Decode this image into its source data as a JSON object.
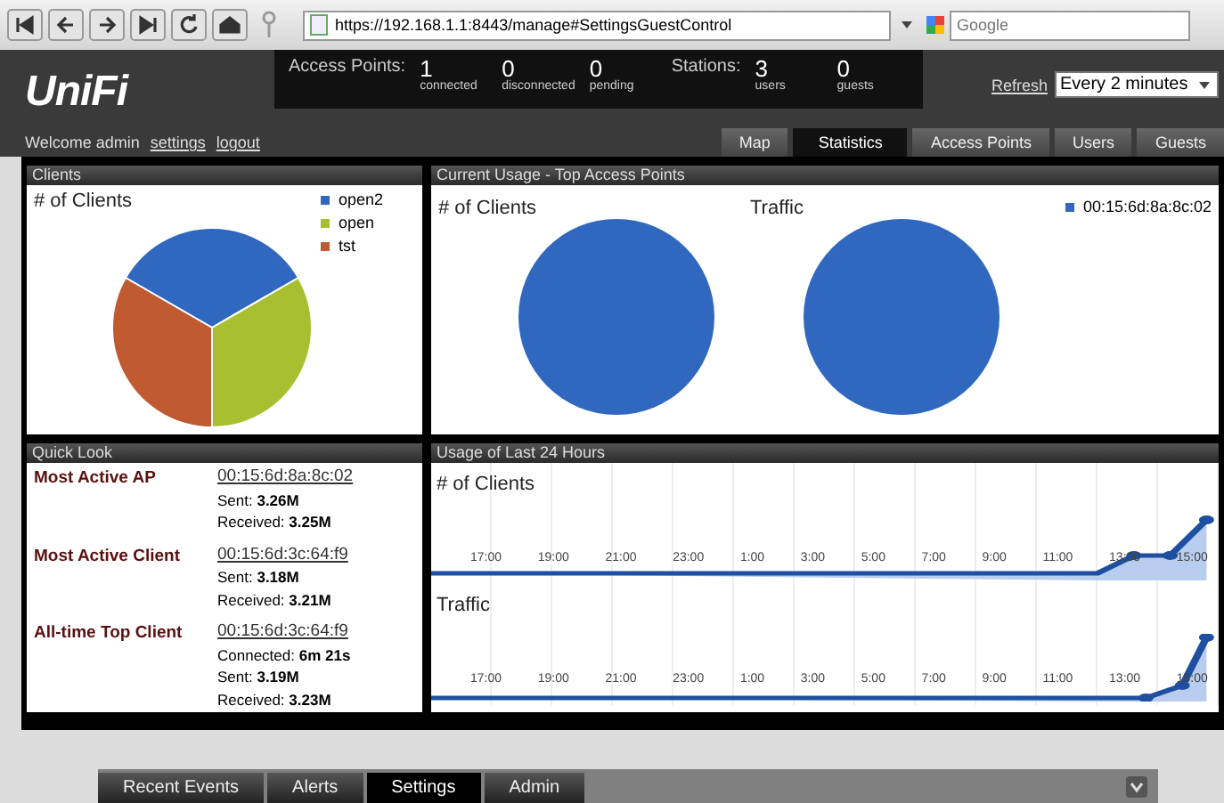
{
  "browser": {
    "url": "https://192.168.1.1:8443/manage#SettingsGuestControl",
    "search": {
      "placeholder": "Google"
    }
  },
  "header": {
    "logo": "UniFi",
    "welcome": "Welcome admin",
    "links": [
      "settings",
      "logout"
    ],
    "stats": [
      {
        "label": "Access Points:",
        "items": [
          {
            "value": "1",
            "caption": "connected"
          },
          {
            "value": "0",
            "caption": "disconnected"
          },
          {
            "value": "0",
            "caption": "pending"
          }
        ]
      },
      {
        "label": "Stations:",
        "items": [
          {
            "value": "3",
            "caption": "users"
          },
          {
            "value": "0",
            "caption": "guests"
          }
        ]
      }
    ],
    "refresh": {
      "label": "Refresh",
      "value": "Every 2 minutes"
    }
  },
  "tabs": [
    {
      "label": "Map",
      "selected": false
    },
    {
      "label": "Statistics",
      "selected": true
    },
    {
      "label": "Access Points",
      "selected": false
    },
    {
      "label": "Users",
      "selected": false
    },
    {
      "label": "Guests",
      "selected": false
    }
  ],
  "clients_panel": {
    "title": "Clients",
    "chart_title": "# of Clients",
    "legend": [
      {
        "label": "open2",
        "color": "#3068c0"
      },
      {
        "label": "open",
        "color": "#a8c030"
      },
      {
        "label": "tst",
        "color": "#c05a30"
      }
    ]
  },
  "usage_panel": {
    "title": "Current Usage - Top Access Points",
    "chart_titles": [
      "# of Clients",
      "Traffic"
    ],
    "legend": [
      {
        "label": "00:15:6d:8a:8c:02",
        "color": "#3068c0"
      }
    ]
  },
  "quick_look": {
    "title": "Quick Look",
    "entries": [
      {
        "label": "Most Active AP",
        "link": "00:15:6d:8a:8c:02",
        "lines": [
          "Sent: **3.26M**",
          "Received: **3.25M**"
        ]
      },
      {
        "label": "Most Active Client",
        "link": "00:15:6d:3c:64:f9",
        "lines": [
          "Sent: **3.18M**",
          "Received: **3.21M**"
        ]
      },
      {
        "label": "All-time Top Client",
        "link": "00:15:6d:3c:64:f9",
        "lines": [
          "Connected: **6m 21s**",
          "Sent: **3.19M**",
          "Received: **3.23M**"
        ]
      }
    ]
  },
  "history_panel": {
    "title": "Usage of Last 24 Hours",
    "charts": [
      {
        "title": "# of Clients",
        "x_labels": [
          "17:00",
          "19:00",
          "21:00",
          "23:00",
          "1:00",
          "3:00",
          "5:00",
          "7:00",
          "9:00",
          "11:00",
          "13:00",
          "15:00"
        ]
      },
      {
        "title": "Traffic",
        "x_labels": [
          "17:00",
          "19:00",
          "21:00",
          "23:00",
          "1:00",
          "3:00",
          "5:00",
          "7:00",
          "9:00",
          "11:00",
          "13:00",
          "15:00"
        ]
      }
    ]
  },
  "bottom_tabs": [
    {
      "label": "Recent Events",
      "selected": false
    },
    {
      "label": "Alerts",
      "selected": false
    },
    {
      "label": "Settings",
      "selected": true
    },
    {
      "label": "Admin",
      "selected": false
    }
  ]
}
